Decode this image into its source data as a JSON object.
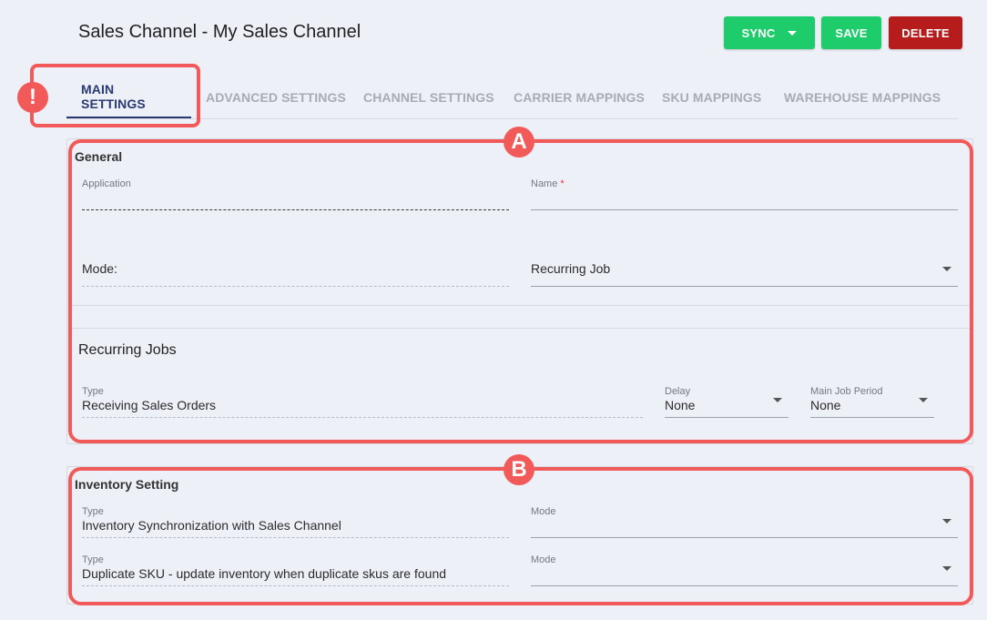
{
  "header": {
    "title": "Sales Channel - My Sales Channel",
    "sync_label": "SYNC",
    "save_label": "SAVE",
    "delete_label": "DELETE"
  },
  "tabs": [
    {
      "label": "MAIN SETTINGS",
      "active": true
    },
    {
      "label": "ADVANCED SETTINGS",
      "active": false
    },
    {
      "label": "CHANNEL SETTINGS",
      "active": false
    },
    {
      "label": "CARRIER MAPPINGS",
      "active": false
    },
    {
      "label": "SKU MAPPINGS",
      "active": false
    },
    {
      "label": "WAREHOUSE MAPPINGS",
      "active": false
    }
  ],
  "annotations": {
    "tab_alert": "!",
    "section_a": "A",
    "section_b": "B",
    "color": "#f25a5a"
  },
  "general": {
    "title": "General",
    "application_label": "Application",
    "application_value": "",
    "name_label": "Name",
    "name_required": "*",
    "name_value": "",
    "mode_label": "Mode:",
    "mode_value": "Recurring Job"
  },
  "recurring_jobs": {
    "title": "Recurring Jobs",
    "type_label": "Type",
    "type_value": "Receiving Sales Orders",
    "delay_label": "Delay",
    "delay_value": "None",
    "period_label": "Main Job Period",
    "period_value": "None"
  },
  "inventory": {
    "title": "Inventory Setting",
    "rows": [
      {
        "type_label": "Type",
        "type_value": "Inventory Synchronization with Sales Channel",
        "mode_label": "Mode",
        "mode_value": ""
      },
      {
        "type_label": "Type",
        "type_value": "Duplicate SKU - update inventory when duplicate skus are found",
        "mode_label": "Mode",
        "mode_value": ""
      }
    ]
  },
  "colors": {
    "primary_green": "#1fcc6c",
    "delete_red": "#b71c1c",
    "active_tab": "#2a3a6e",
    "background": "#eef0f8"
  }
}
